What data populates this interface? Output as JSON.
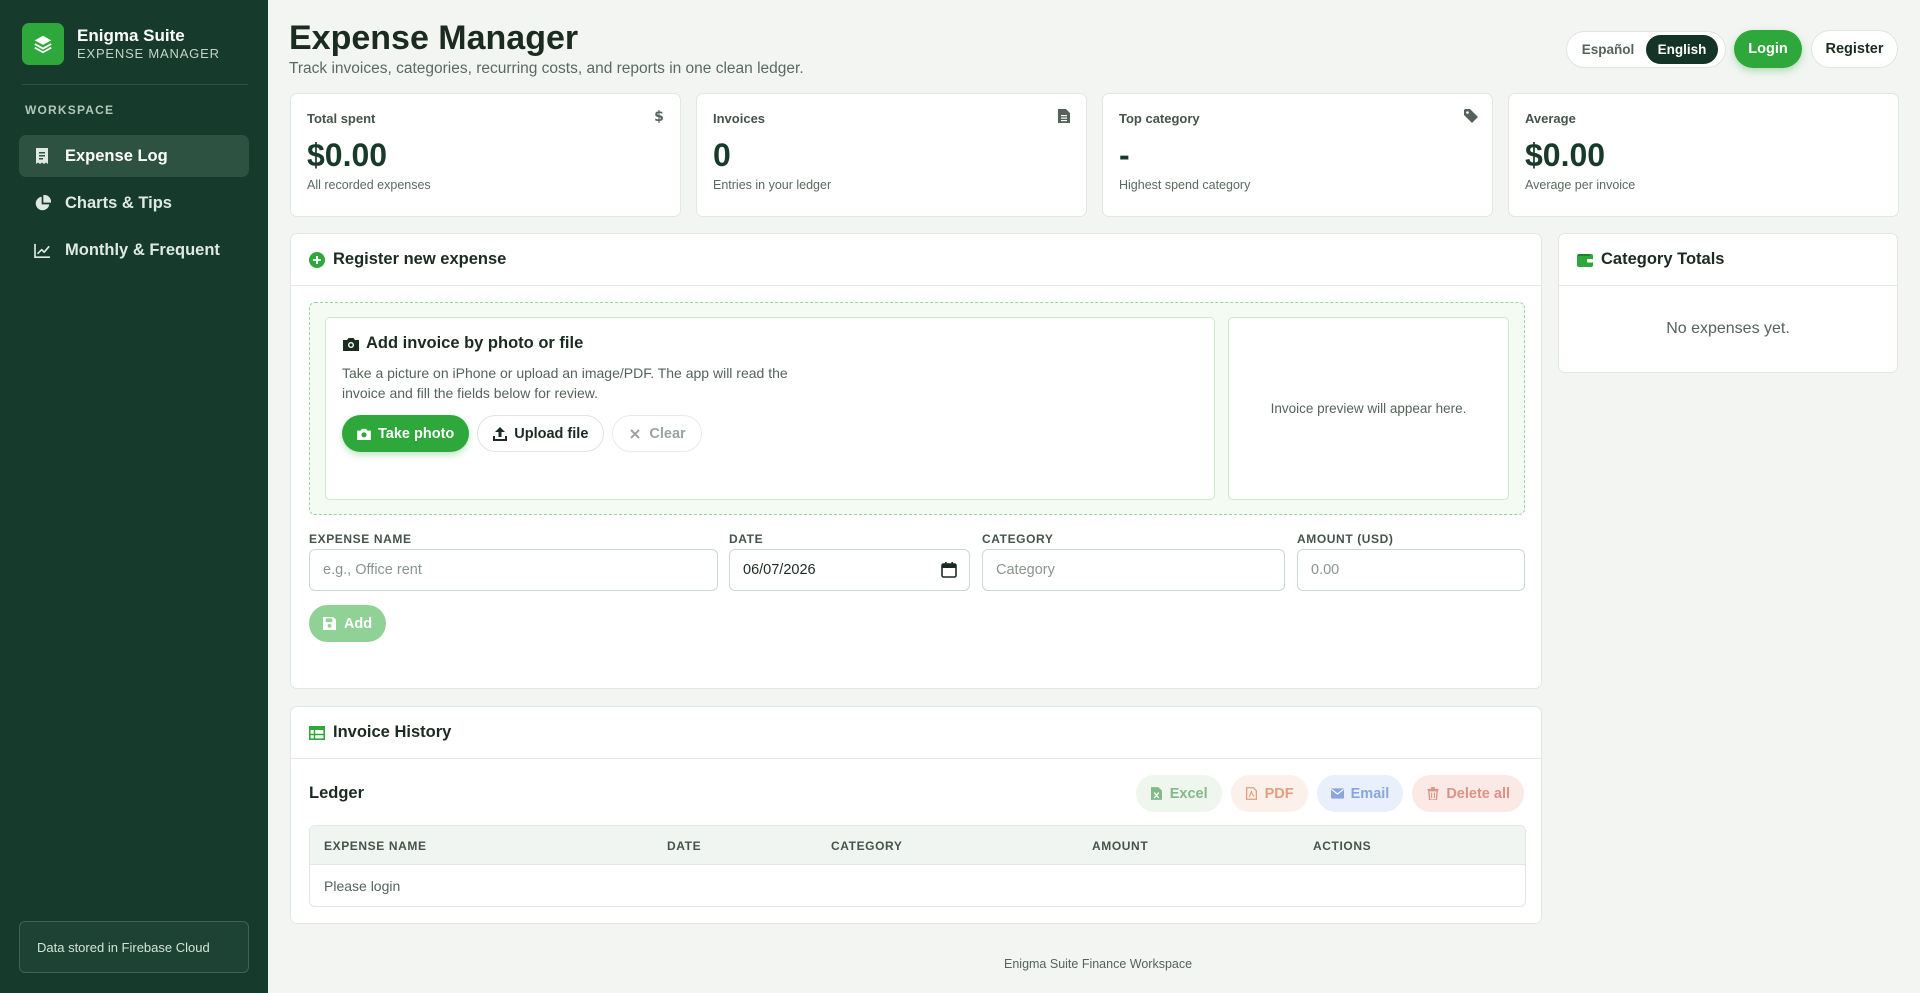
{
  "sidebar": {
    "brand_name": "Enigma Suite",
    "brand_sub": "EXPENSE MANAGER",
    "section": "WORKSPACE",
    "items": [
      {
        "label": "Expense Log",
        "icon": "receipt-icon",
        "active": true
      },
      {
        "label": "Charts & Tips",
        "icon": "pie-chart-icon",
        "active": false
      },
      {
        "label": "Monthly & Frequent",
        "icon": "line-chart-icon",
        "active": false
      }
    ],
    "storage_note": "Data stored in Firebase Cloud"
  },
  "header": {
    "title": "Expense Manager",
    "subtitle": "Track invoices, categories, recurring costs, and reports in one clean ledger.",
    "lang_es": "Español",
    "lang_en": "English",
    "login": "Login",
    "register": "Register"
  },
  "stats": [
    {
      "label": "Total spent",
      "value": "$0.00",
      "hint": "All recorded expenses",
      "icon": "dollar-icon"
    },
    {
      "label": "Invoices",
      "value": "0",
      "hint": "Entries in your ledger",
      "icon": "document-icon"
    },
    {
      "label": "Top category",
      "value": "-",
      "hint": "Highest spend category",
      "icon": "tag-icon"
    },
    {
      "label": "Average",
      "value": "$0.00",
      "hint": "Average per invoice",
      "icon": ""
    }
  ],
  "register": {
    "title": "Register new expense",
    "upload_title": "Add invoice by photo or file",
    "upload_desc": "Take a picture on iPhone or upload an image/PDF. The app will read the invoice and fill the fields below for review.",
    "take_photo": "Take photo",
    "upload_file": "Upload file",
    "clear": "Clear",
    "preview": "Invoice preview will appear here.",
    "fields": {
      "name_label": "EXPENSE NAME",
      "name_placeholder": "e.g., Office rent",
      "date_label": "DATE",
      "date_value": "06/07/2026",
      "category_label": "CATEGORY",
      "category_placeholder": "Category",
      "amount_label": "AMOUNT (USD)",
      "amount_placeholder": "0.00"
    },
    "add": "Add"
  },
  "history": {
    "title": "Invoice History",
    "ledger": "Ledger",
    "excel": "Excel",
    "pdf": "PDF",
    "email": "Email",
    "delete_all": "Delete all",
    "columns": [
      "EXPENSE NAME",
      "DATE",
      "CATEGORY",
      "AMOUNT",
      "ACTIONS"
    ],
    "empty": "Please login"
  },
  "category_totals": {
    "title": "Category Totals",
    "empty": "No expenses yet."
  },
  "footer": "Enigma Suite Finance Workspace",
  "colors": {
    "sidebar_bg": "#163a2b",
    "accent": "#2ea83a",
    "dark_pill": "#143427"
  }
}
